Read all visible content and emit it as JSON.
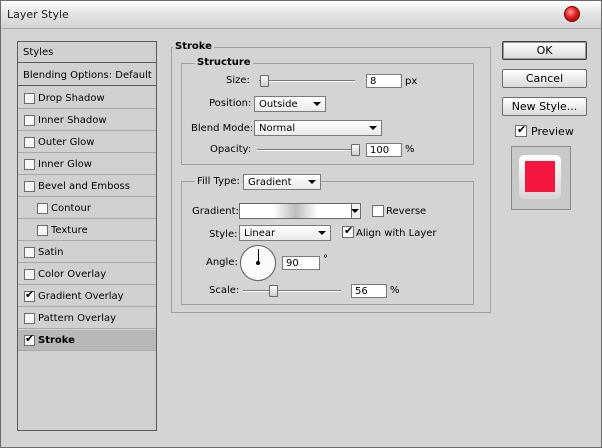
{
  "window": {
    "title": "Layer Style"
  },
  "styles_list": {
    "header": "Styles",
    "blending": "Blending Options: Default",
    "items": [
      {
        "label": "Drop Shadow",
        "checked": false
      },
      {
        "label": "Inner Shadow",
        "checked": false
      },
      {
        "label": "Outer Glow",
        "checked": false
      },
      {
        "label": "Inner Glow",
        "checked": false
      },
      {
        "label": "Bevel and Emboss",
        "checked": false
      },
      {
        "label": "Contour",
        "checked": false
      },
      {
        "label": "Texture",
        "checked": false
      },
      {
        "label": "Satin",
        "checked": false
      },
      {
        "label": "Color Overlay",
        "checked": false
      },
      {
        "label": "Gradient Overlay",
        "checked": true
      },
      {
        "label": "Pattern Overlay",
        "checked": false
      },
      {
        "label": "Stroke",
        "checked": true,
        "selected": true
      }
    ]
  },
  "stroke": {
    "title": "Stroke",
    "structure": {
      "title": "Structure",
      "size_label": "Size:",
      "size_value": "8",
      "size_unit": "px",
      "position_label": "Position:",
      "position_value": "Outside",
      "blend_label": "Blend Mode:",
      "blend_value": "Normal",
      "opacity_label": "Opacity:",
      "opacity_value": "100",
      "opacity_unit": "%"
    },
    "fill": {
      "filltype_label": "Fill Type:",
      "filltype_value": "Gradient",
      "gradient_label": "Gradient:",
      "reverse_label": "Reverse",
      "reverse_checked": false,
      "style_label": "Style:",
      "style_value": "Linear",
      "align_label": "Align with Layer",
      "align_checked": true,
      "angle_label": "Angle:",
      "angle_value": "90",
      "angle_unit": "°",
      "scale_label": "Scale:",
      "scale_value": "56",
      "scale_unit": "%"
    }
  },
  "buttons": {
    "ok": "OK",
    "cancel": "Cancel",
    "new_style": "New Style...",
    "preview_label": "Preview",
    "preview_checked": true
  },
  "colors": {
    "preview_fill": "#f4163e"
  }
}
